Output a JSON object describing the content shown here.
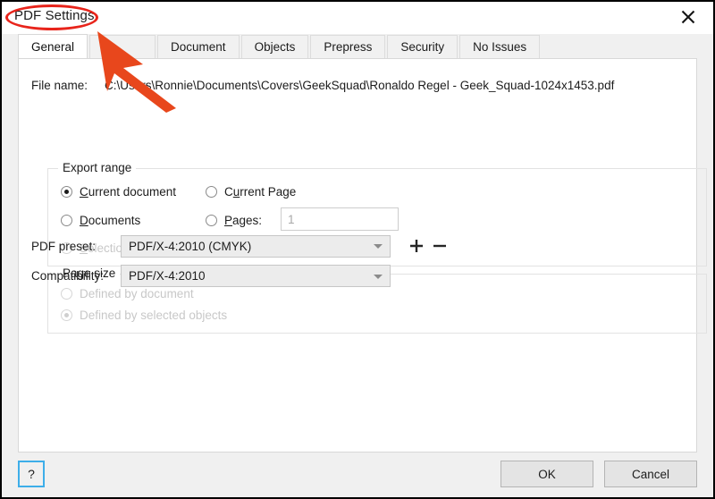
{
  "window": {
    "title": "PDF Settings",
    "close_icon": "close-icon"
  },
  "tabs": [
    {
      "label": "General",
      "active": true
    },
    {
      "label": "",
      "active": false,
      "obscured": true
    },
    {
      "label": "Document",
      "active": false
    },
    {
      "label": "Objects",
      "active": false
    },
    {
      "label": "Prepress",
      "active": false
    },
    {
      "label": "Security",
      "active": false
    },
    {
      "label": "No Issues",
      "active": false
    }
  ],
  "general": {
    "file_name_label": "File name:",
    "file_name_value": "C:\\Users\\Ronnie\\Documents\\Covers\\GeekSquad\\Ronaldo Regel - Geek_Squad-1024x1453.pdf",
    "export_range": {
      "legend": "Export range",
      "options": [
        {
          "label_pre": "",
          "mnemonic": "C",
          "label_post": "urrent document",
          "checked": true,
          "disabled": false
        },
        {
          "label_pre": "C",
          "mnemonic": "u",
          "label_post": "rrent Page",
          "checked": false,
          "disabled": false
        },
        {
          "label_pre": "",
          "mnemonic": "D",
          "label_post": "ocuments",
          "checked": false,
          "disabled": false
        },
        {
          "label_pre": "",
          "mnemonic": "P",
          "label_post": "ages:",
          "checked": false,
          "disabled": false
        },
        {
          "label_pre": "",
          "mnemonic": "S",
          "label_post": "election",
          "checked": false,
          "disabled": true
        }
      ],
      "pages_value": "1"
    },
    "page_size": {
      "legend": "Page size",
      "options": [
        {
          "label": "Defined by document",
          "checked": false,
          "disabled": true
        },
        {
          "label": "Defined by selected objects",
          "checked": true,
          "disabled": true
        }
      ]
    },
    "preset": {
      "label": "PDF preset:",
      "value": "PDF/X-4:2010 (CMYK)",
      "add_label": "+",
      "remove_label": "−"
    },
    "compatibility": {
      "label": "Compatibility:",
      "value": "PDF/X-4:2010"
    }
  },
  "footer": {
    "help_label": "?",
    "ok_label": "OK",
    "cancel_label": "Cancel"
  },
  "annotations": {
    "highlight_color": "#e8241b",
    "arrow_color": "#e8471c"
  }
}
